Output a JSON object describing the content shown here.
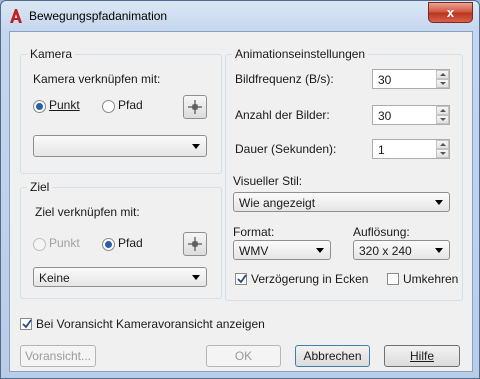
{
  "window": {
    "title": "Bewegungspfadanimation",
    "close_glyph": "x"
  },
  "icons": {
    "app": "autocad-a-icon",
    "close": "close-icon",
    "pick": "crosshair-pick-icon",
    "dropdown": "chevron-down-icon",
    "check": "checkmark-icon"
  },
  "kamera": {
    "group_title": "Kamera",
    "link_label": "Kamera verknüpfen mit:",
    "radio_point": "Punkt",
    "radio_path": "Pfad",
    "selected": "Punkt",
    "combo_value": ""
  },
  "ziel": {
    "group_title": "Ziel",
    "link_label": "Ziel verknüpfen mit:",
    "radio_point": "Punkt",
    "radio_path": "Pfad",
    "selected": "Pfad",
    "combo_value": "Keine"
  },
  "anim": {
    "group_title": "Animationseinstellungen",
    "framerate_label": "Bildfrequenz (B/s):",
    "framerate_value": "30",
    "frames_label": "Anzahl der Bilder:",
    "frames_value": "30",
    "duration_label": "Dauer (Sekunden):",
    "duration_value": "1",
    "style_label": "Visueller Stil:",
    "style_value": "Wie angezeigt",
    "format_label": "Format:",
    "format_value": "WMV",
    "resolution_label": "Auflösung:",
    "resolution_value": "320 x 240",
    "corner_delay_label": "Verzögerung in Ecken",
    "corner_delay_checked": true,
    "reverse_label": "Umkehren",
    "reverse_checked": false
  },
  "preview_camera_label": "Bei Voransicht Kameravoransicht anzeigen",
  "preview_camera_checked": true,
  "buttons": {
    "preview": "Voransicht...",
    "ok": "OK",
    "cancel": "Abbrechen",
    "help": "Hilfe"
  },
  "colors": {
    "accent": "#2b5fa8",
    "close": "#c8432c",
    "brand": "#c0201f"
  }
}
